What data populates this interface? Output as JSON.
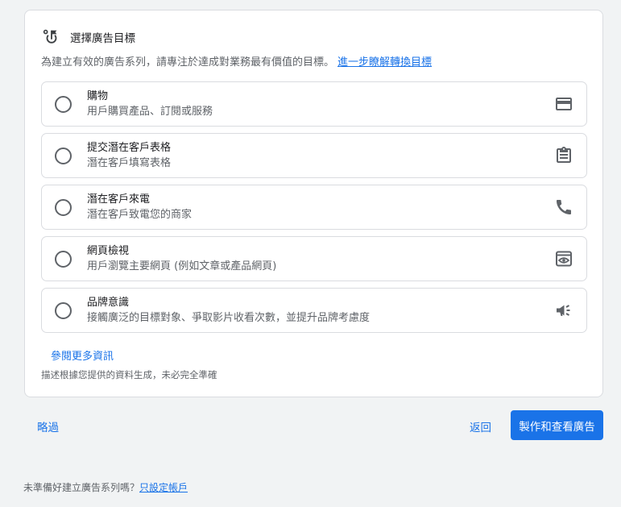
{
  "card": {
    "title": "選擇廣告目標",
    "title_icon": "goal-flag-icon",
    "intro_text": "為建立有效的廣告系列，請專注於達成對業務最有價值的目標。",
    "learn_more_link": "進一步瞭解轉換目標"
  },
  "options": [
    {
      "title": "購物",
      "description": "用戶購買產品、訂閱或服務",
      "icon": "credit-card-icon",
      "selected": false
    },
    {
      "title": "提交潛在客戶表格",
      "description": "潛在客戶填寫表格",
      "icon": "clipboard-icon",
      "selected": false
    },
    {
      "title": "潛在客戶來電",
      "description": "潛在客戶致電您的商家",
      "icon": "phone-icon",
      "selected": false
    },
    {
      "title": "網頁檢視",
      "description": "用戶瀏覽主要網頁 (例如文章或產品網頁)",
      "icon": "webpage-view-icon",
      "selected": false
    },
    {
      "title": "品牌意識",
      "description": "接觸廣泛的目標對象、爭取影片收看次數，並提升品牌考慮度",
      "icon": "megaphone-icon",
      "selected": false
    }
  ],
  "more_info_link": "參閱更多資訊",
  "disclaimer": "描述根據您提供的資料生成，未必完全準確",
  "actions": {
    "skip": "略過",
    "back": "返回",
    "primary": "製作和查看廣告"
  },
  "footer": {
    "text": "未準備好建立廣告系列嗎？",
    "link": "只設定帳戶"
  },
  "colors": {
    "accent": "#1a73e8",
    "background": "#f1f3f4",
    "card": "#ffffff",
    "border": "#dadce0"
  }
}
